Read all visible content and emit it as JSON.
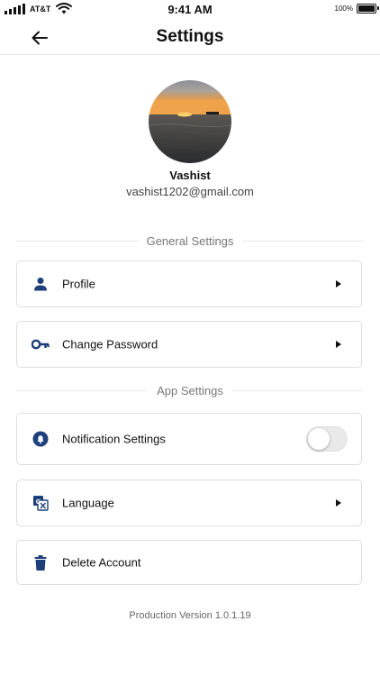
{
  "status_bar": {
    "carrier": "AT&T",
    "time": "9:41 AM",
    "battery": "100%"
  },
  "header": {
    "title": "Settings",
    "back_icon": "arrow-left-icon"
  },
  "profile": {
    "name": "Vashist",
    "email": "vashist1202@gmail.com"
  },
  "sections": {
    "general": "General Settings",
    "app": "App Settings"
  },
  "items": {
    "profile": {
      "label": "Profile",
      "icon": "person-icon"
    },
    "change_password": {
      "label": "Change Password",
      "icon": "key-icon"
    },
    "notification_settings": {
      "label": "Notification Settings",
      "icon": "bell-icon",
      "enabled": false
    },
    "language": {
      "label": "Language",
      "icon": "translate-icon"
    },
    "delete_account": {
      "label": "Delete Account",
      "icon": "trash-icon"
    }
  },
  "footer": {
    "version": "Production Version 1.0.1.19"
  },
  "colors": {
    "icon_blue": "#1d3f7a",
    "toggle_off": "#e9e9ea"
  }
}
